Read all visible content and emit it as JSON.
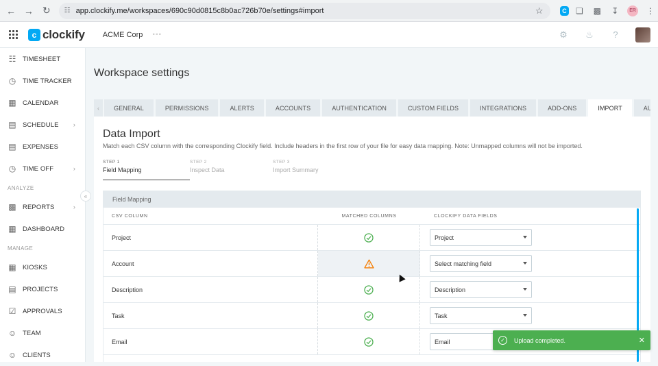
{
  "browser": {
    "url": "app.clockify.me/workspaces/690c90d0815c8b0ac726b70e/settings#import",
    "profile_initials": "ER"
  },
  "header": {
    "logo_text": "clockify",
    "workspace": "ACME Corp"
  },
  "sidebar": {
    "items": [
      {
        "label": "TIMESHEET",
        "icon": "timesheet-icon"
      },
      {
        "label": "TIME TRACKER",
        "icon": "clock-icon"
      },
      {
        "label": "CALENDAR",
        "icon": "calendar-icon"
      },
      {
        "label": "SCHEDULE",
        "icon": "schedule-icon"
      },
      {
        "label": "EXPENSES",
        "icon": "receipt-icon"
      },
      {
        "label": "TIME OFF",
        "icon": "time-off-icon"
      }
    ],
    "section_analyze": "ANALYZE",
    "analyze_items": [
      {
        "label": "REPORTS",
        "icon": "reports-icon"
      },
      {
        "label": "DASHBOARD",
        "icon": "dashboard-icon"
      }
    ],
    "section_manage": "MANAGE",
    "manage_items": [
      {
        "label": "KIOSKS",
        "icon": "kiosk-icon"
      },
      {
        "label": "PROJECTS",
        "icon": "projects-icon"
      },
      {
        "label": "APPROVALS",
        "icon": "approvals-icon"
      },
      {
        "label": "TEAM",
        "icon": "team-icon"
      },
      {
        "label": "CLIENTS",
        "icon": "clients-icon"
      }
    ]
  },
  "page": {
    "title": "Workspace settings",
    "tabs": [
      "GENERAL",
      "PERMISSIONS",
      "ALERTS",
      "ACCOUNTS",
      "AUTHENTICATION",
      "CUSTOM FIELDS",
      "INTEGRATIONS",
      "ADD-ONS",
      "IMPORT",
      "AUDIT LO"
    ],
    "active_tab": "IMPORT"
  },
  "import": {
    "title": "Data Import",
    "description": "Match each CSV column with the corresponding Clockify field. Include headers in the first row of your file for easy data mapping. Note: Unmapped columns will not be imported.",
    "steps": [
      {
        "num": "STEP 1",
        "label": "Field Mapping"
      },
      {
        "num": "STEP 2",
        "label": "Inspect Data"
      },
      {
        "num": "STEP 3",
        "label": "Import Summary"
      }
    ],
    "section_title": "Field Mapping",
    "columns": {
      "csv": "CSV COLUMN",
      "matched": "MATCHED COLUMNS",
      "fields": "CLOCKIFY DATA FIELDS"
    },
    "rows": [
      {
        "csv": "Project",
        "status": "matched",
        "field": "Project"
      },
      {
        "csv": "Account",
        "status": "warning",
        "field": "Select matching field"
      },
      {
        "csv": "Description",
        "status": "matched",
        "field": "Description"
      },
      {
        "csv": "Task",
        "status": "matched",
        "field": "Task"
      },
      {
        "csv": "Email",
        "status": "matched",
        "field": "Email"
      }
    ]
  },
  "toast": {
    "message": "Upload completed.",
    "color": "#4caf50"
  },
  "colors": {
    "accent": "#03a9f4",
    "success": "#4caf50",
    "warning": "#f57c00"
  }
}
